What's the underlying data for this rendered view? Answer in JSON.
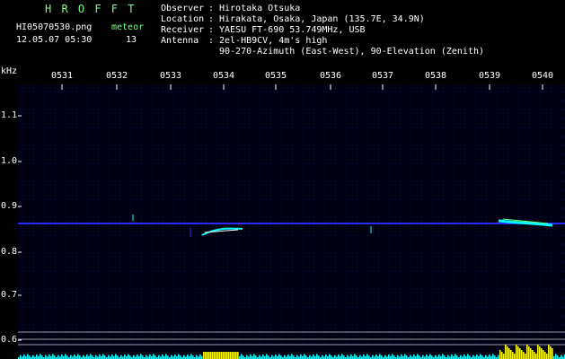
{
  "header": {
    "program_title": "H R O F F T",
    "filename": "HI05070530.png",
    "datetime": "12.05.07 05:30",
    "meteor_label": "meteor",
    "meteor_count": "13",
    "fields": [
      {
        "key": "Observer",
        "value": "Hirotaka Otsuka"
      },
      {
        "key": "Location",
        "value": "Hirakata, Osaka, Japan (135.7E, 34.9N)"
      },
      {
        "key": "Receiver",
        "value": "YAESU FT-690 53.749MHz, USB"
      },
      {
        "key": "Antenna ",
        "value": "2el-HB9CV, 4m's high"
      }
    ],
    "antenna_line2": "90-270-Azimuth (East-West), 90-Elevation (Zenith)"
  },
  "axes": {
    "y_unit": "kHz",
    "y_ticks": [
      "1.1",
      "1.0",
      "0.9",
      "0.8",
      "0.7",
      "0.6"
    ],
    "x_ticks": [
      "0531",
      "0532",
      "0533",
      "0534",
      "0535",
      "0536",
      "0537",
      "0538",
      "0539",
      "0540"
    ]
  },
  "colors": {
    "background": "#000000",
    "spectrum_bg": "#000010",
    "grid": "#1a1a66",
    "carrier": "#2a2aff",
    "echo": "#00ffff",
    "histogram": "#ffff00",
    "histogram_base": "#00ffff",
    "title_green": "#7fff7f"
  }
}
